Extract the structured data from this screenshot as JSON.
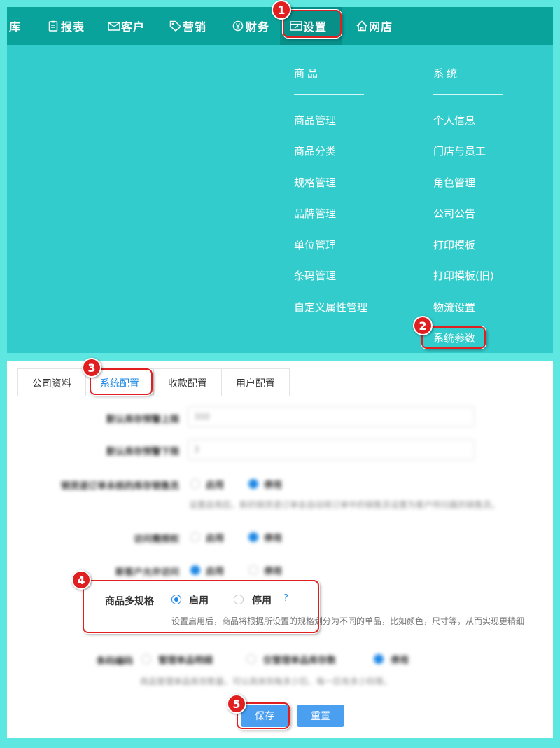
{
  "nav": {
    "items": [
      {
        "label": "库"
      },
      {
        "label": "报表"
      },
      {
        "label": "客户"
      },
      {
        "label": "营销"
      },
      {
        "label": "财务"
      },
      {
        "label": "设置"
      },
      {
        "label": "网店"
      }
    ]
  },
  "menu": {
    "col1": {
      "heading": "商品",
      "links": [
        "商品管理",
        "商品分类",
        "规格管理",
        "品牌管理",
        "单位管理",
        "条码管理",
        "自定义属性管理"
      ]
    },
    "col2": {
      "heading": "系统",
      "links": [
        "个人信息",
        "门店与员工",
        "角色管理",
        "公司公告",
        "打印模板",
        "打印模板(旧)",
        "物流设置",
        "系统参数"
      ]
    }
  },
  "tabs": [
    "公司资料",
    "系统配置",
    "收款配置",
    "用户配置"
  ],
  "form": {
    "upper_label": "默认库存预警上限",
    "upper_value": "300",
    "lower_label": "默认库存预警下限",
    "lower_value": "3",
    "row3_label": "销货退订单未核的库存销售员",
    "row3_on": "启用",
    "row3_off": "停用",
    "row3_hint": "设置启用后，新的销货退订单会自动将订单中的销售员设置为客户所归属的销售员。",
    "row4_label": "访问需授权",
    "row4_on": "启用",
    "row4_off": "停用",
    "row5_label": "新客户允许访问",
    "row5_on": "启用",
    "row5_off": "停用",
    "multi_label": "商品多规格",
    "multi_on": "启用",
    "multi_off": "停用",
    "multi_help": "?",
    "multi_hint": "设置启用后，商品将根据所设置的规格划分为不同的单品，比如颜色，尺寸等，从而实现更精细",
    "row7_label": "条码编码",
    "row7_opt1": "管理单品明细",
    "row7_opt2": "仅管理单品库存数",
    "row7_opt3": "停用",
    "row7_hint": "商品管理单品库存数量，可以具体到每多少匹、每一匹有多少码等。"
  },
  "buttons": {
    "save": "保存",
    "reset": "重置"
  },
  "badges": [
    "1",
    "2",
    "3",
    "4",
    "5"
  ],
  "colors": {
    "nav_bg": "#0aa39b",
    "menu_bg": "#33cccc",
    "accent": "#1e88e5",
    "button": "#4a9ff0",
    "highlight": "#e02020"
  }
}
